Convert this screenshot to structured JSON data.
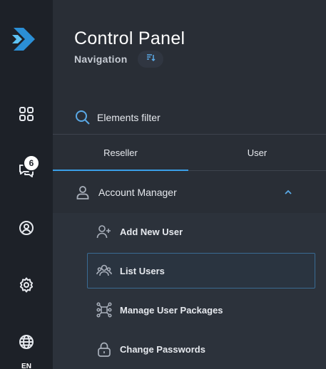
{
  "sidebar": {
    "badge_count": "6",
    "language": "EN",
    "icons": [
      "logo-icon",
      "dashboard-icon",
      "chat-icon",
      "account-icon",
      "settings-icon",
      "globe-icon"
    ]
  },
  "header": {
    "title": "Control Panel",
    "subtitle": "Navigation"
  },
  "search": {
    "placeholder": "Elements filter"
  },
  "tabs": [
    {
      "label": "Reseller",
      "active": true
    },
    {
      "label": "User",
      "active": false
    }
  ],
  "section": {
    "label": "Account Manager",
    "expanded": true
  },
  "menu_items": [
    {
      "label": "Add New User",
      "icon": "add-user-icon"
    },
    {
      "label": "List Users",
      "icon": "users-icon",
      "active": true
    },
    {
      "label": "Manage User Packages",
      "icon": "packages-icon"
    },
    {
      "label": "Change Passwords",
      "icon": "lock-icon"
    }
  ],
  "colors": {
    "rail_bg": "#1d2128",
    "panel_bg": "#292e36",
    "accent": "#3a9fe8",
    "active_border": "#3a6b93"
  }
}
